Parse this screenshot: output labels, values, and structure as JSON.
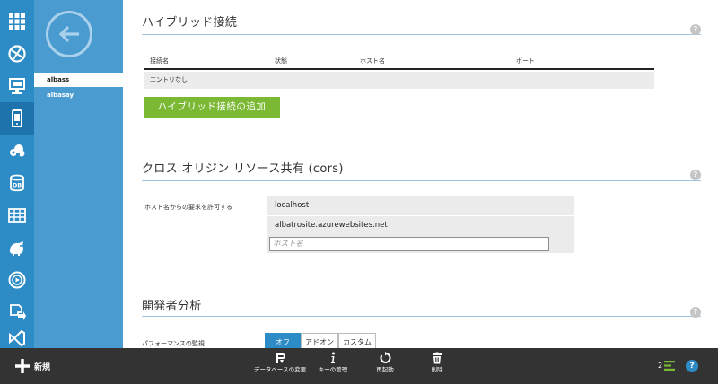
{
  "nav": {
    "items": [
      {
        "label": "albass",
        "selected": true
      },
      {
        "label": "albasay",
        "selected": false
      }
    ]
  },
  "rail_icons": [
    "all-items-icon",
    "websites-icon",
    "virtual-machines-icon",
    "mobile-services-icon",
    "cloud-services-icon",
    "sql-databases-icon",
    "storage-icon",
    "hdinsight-icon",
    "media-services-icon",
    "service-bus-icon",
    "visual-studio-icon"
  ],
  "hybrid": {
    "title": "ハイブリッド接続",
    "columns": [
      "接続名",
      "状態",
      "ホスト名",
      "ポート"
    ],
    "empty_text": "エントリなし",
    "add_button": "ハイブリッド接続の追加",
    "help": "?"
  },
  "cors": {
    "title": "クロス オリジン リソース共有 (cors)",
    "label": "ホスト名からの要求を許可する",
    "hosts": [
      "localhost",
      "albatrosite.azurewebsites.net"
    ],
    "input_placeholder": "ホスト名",
    "help": "?"
  },
  "dev": {
    "title": "開発者分析",
    "perf_label": "パフォーマンスの監視",
    "options": [
      "オフ",
      "アドオン",
      "カスタム"
    ],
    "selected_option": "オフ",
    "help": "?"
  },
  "cmdbar": {
    "new_label": "新規",
    "commands": [
      {
        "label": "データベースの変更",
        "icon": "database-change-icon"
      },
      {
        "label": "キーの管理",
        "icon": "info-icon"
      },
      {
        "label": "再起動",
        "icon": "restart-icon"
      },
      {
        "label": "削除",
        "icon": "trash-icon"
      }
    ],
    "notification_count": "2",
    "help": "?"
  },
  "colors": {
    "rail": "#2d8bc6",
    "nav": "#4a9bd0",
    "accent_green": "#7bb833",
    "command_bar": "#333333"
  }
}
